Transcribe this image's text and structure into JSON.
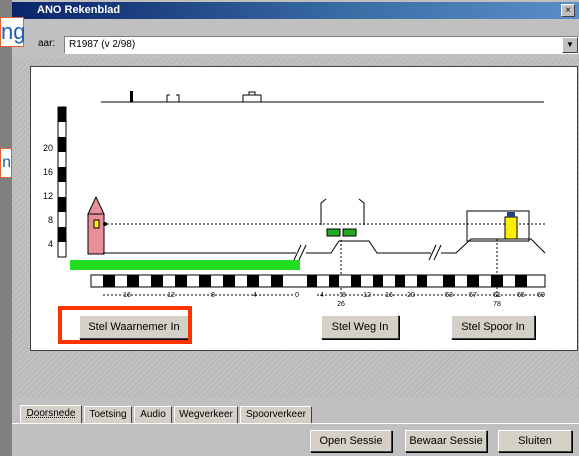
{
  "window": {
    "title": "ANO Rekenblad",
    "close_glyph": "×"
  },
  "header": {
    "label": "aar:",
    "selected": "R1987 (v 2/98)",
    "arrow_glyph": "▼"
  },
  "callouts": {
    "top_text": "ng",
    "mid_text": "n"
  },
  "diagram": {
    "height_scale": [
      "20",
      "16",
      "12",
      "8",
      "4"
    ],
    "ruler_labels_left": [
      "16",
      "12",
      "8",
      "4",
      "0"
    ],
    "ruler_labels_right": [
      "4",
      "8",
      "12",
      "16",
      "20",
      "53",
      "57",
      "61",
      "65",
      "69"
    ],
    "marker_26": "26",
    "marker_78": "78"
  },
  "buttons": {
    "observer": "Stel Waarnemer In",
    "road": "Stel Weg In",
    "rail": "Stel Spoor In",
    "open_session": "Open Sessie",
    "save_session": "Bewaar Sessie",
    "close": "Sluiten"
  },
  "tabs": [
    "Doorsnede",
    "Toetsing",
    "Audio",
    "Wegverkeer",
    "Spoorverkeer"
  ],
  "colors": {
    "highlight": "#ff3300",
    "ground_bar": "#22dd22",
    "house": "#e8909a",
    "titlebar": "#0a246a"
  }
}
